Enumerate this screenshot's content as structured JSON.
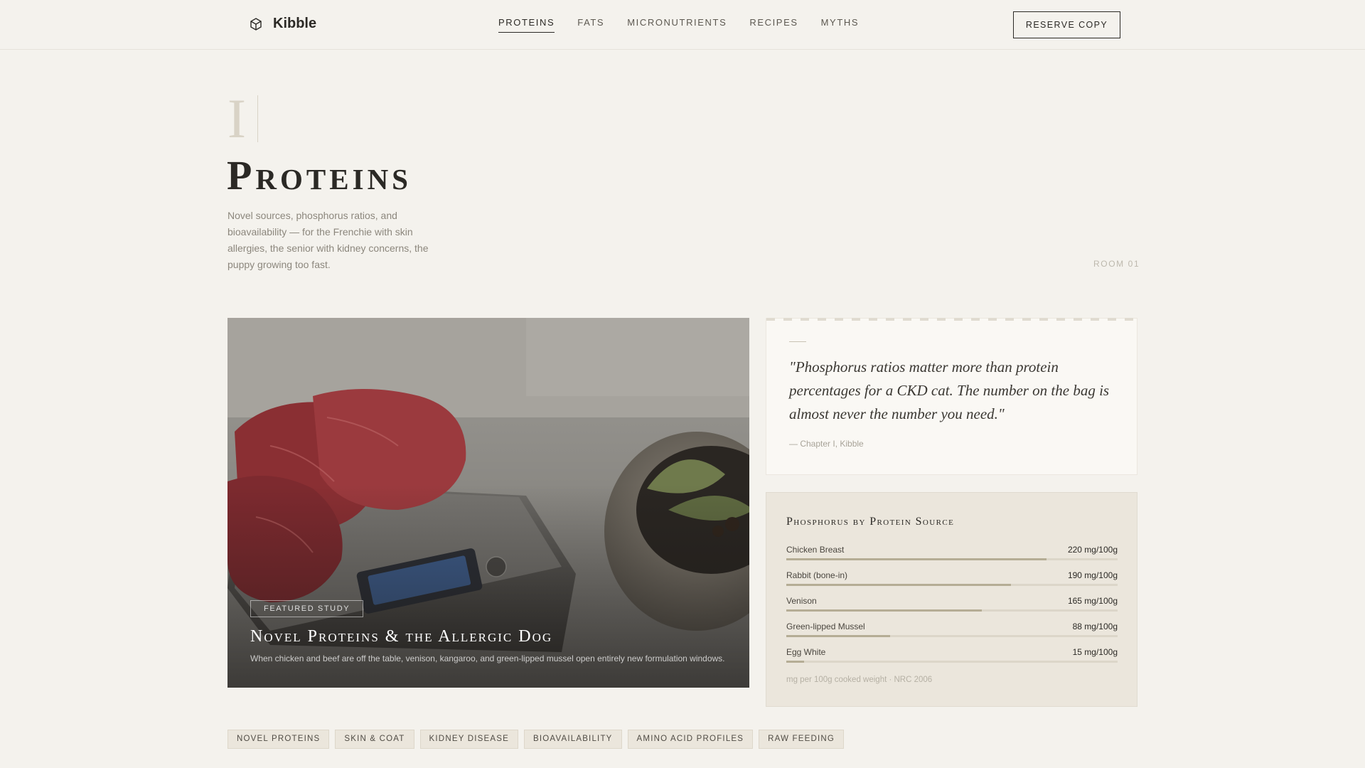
{
  "nav": {
    "brand": "Kibble",
    "links": [
      "PROTEINS",
      "FATS",
      "MICRONUTRIENTS",
      "RECIPES",
      "MYTHS"
    ],
    "active": "PROTEINS",
    "reserve": "RESERVE COPY"
  },
  "hero": {
    "numeral": "I",
    "title": "Proteins",
    "lede": "Novel sources, phosphorus ratios, and bioavailability — for the Frenchie with skin allergies, the senior with kidney concerns, the puppy growing too fast.",
    "room": "ROOM 01"
  },
  "feature": {
    "tag": "FEATURED STUDY",
    "title": "Novel Proteins & the Allergic Dog",
    "desc": "When chicken and beef are off the table, venison, kangaroo, and green-lipped mussel open entirely new formulation windows."
  },
  "quote": {
    "text": "\"Phosphorus ratios matter more than protein percentages for a CKD cat. The number on the bag is almost never the number you need.\"",
    "cite": "— Chapter I, Kibble"
  },
  "phosphorus": {
    "title": "Phosphorus by Protein Source",
    "max": 280,
    "rows": [
      {
        "label": "Chicken Breast",
        "value": 220,
        "display": "220 mg/100g"
      },
      {
        "label": "Rabbit (bone-in)",
        "value": 190,
        "display": "190 mg/100g"
      },
      {
        "label": "Venison",
        "value": 165,
        "display": "165 mg/100g"
      },
      {
        "label": "Green-lipped Mussel",
        "value": 88,
        "display": "88 mg/100g"
      },
      {
        "label": "Egg White",
        "value": 15,
        "display": "15 mg/100g"
      }
    ],
    "note": "mg per 100g cooked weight · NRC 2006"
  },
  "tags": [
    "NOVEL PROTEINS",
    "SKIN & COAT",
    "KIDNEY DISEASE",
    "BIOAVAILABILITY",
    "AMINO ACID PROFILES",
    "RAW FEEDING"
  ]
}
